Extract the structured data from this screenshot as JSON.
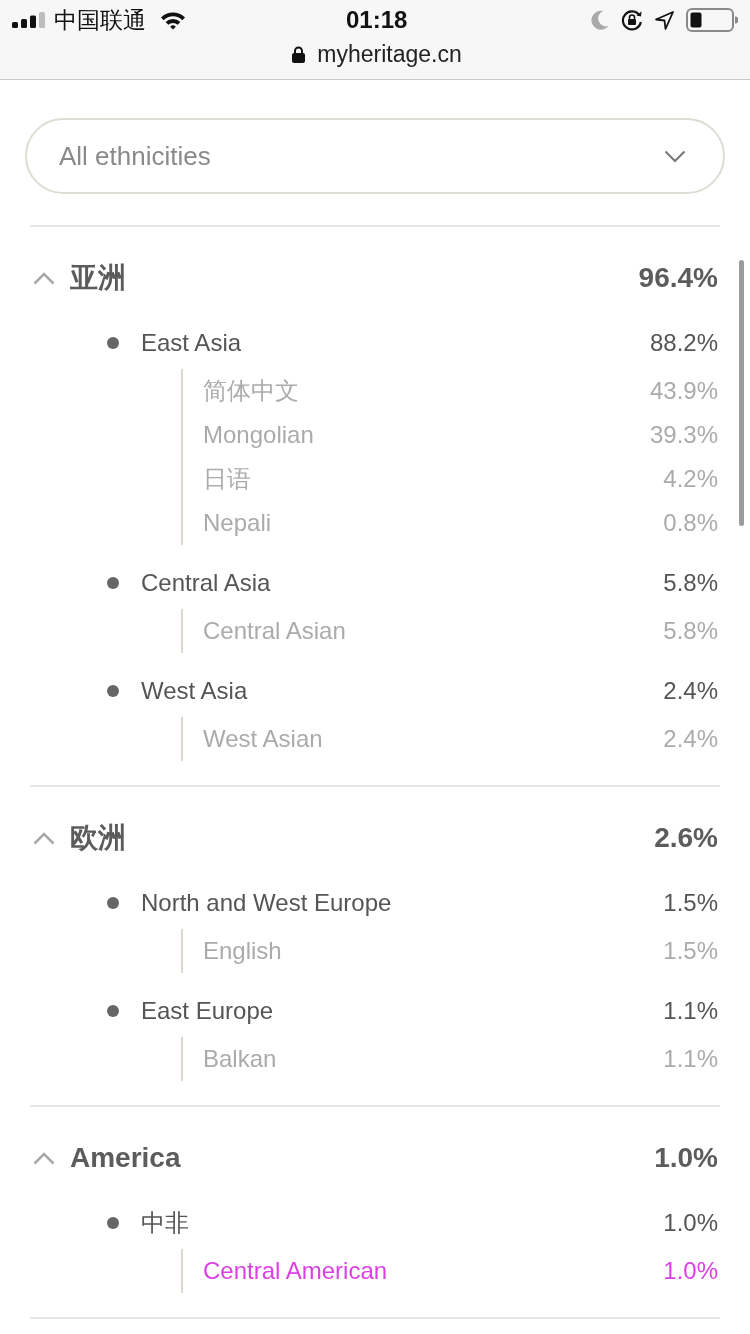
{
  "status_bar": {
    "carrier": "中国联通",
    "time": "01:18"
  },
  "address_bar": {
    "url": "myheritage.cn"
  },
  "filter": {
    "value": "All ethnicities"
  },
  "regions": [
    {
      "name": "亚洲",
      "percent": "96.4%",
      "expanded": true,
      "subregions": [
        {
          "name": "East Asia",
          "percent": "88.2%",
          "children": [
            {
              "name": "简体中文",
              "percent": "43.9%",
              "selected": false
            },
            {
              "name": "Mongolian",
              "percent": "39.3%",
              "selected": false
            },
            {
              "name": "日语",
              "percent": "4.2%",
              "selected": false
            },
            {
              "name": "Nepali",
              "percent": "0.8%",
              "selected": false
            }
          ]
        },
        {
          "name": "Central Asia",
          "percent": "5.8%",
          "children": [
            {
              "name": "Central Asian",
              "percent": "5.8%",
              "selected": false
            }
          ]
        },
        {
          "name": "West Asia",
          "percent": "2.4%",
          "children": [
            {
              "name": "West Asian",
              "percent": "2.4%",
              "selected": false
            }
          ]
        }
      ]
    },
    {
      "name": "欧洲",
      "percent": "2.6%",
      "expanded": true,
      "subregions": [
        {
          "name": "North and West Europe",
          "percent": "1.5%",
          "children": [
            {
              "name": "English",
              "percent": "1.5%",
              "selected": false
            }
          ]
        },
        {
          "name": "East Europe",
          "percent": "1.1%",
          "children": [
            {
              "name": "Balkan",
              "percent": "1.1%",
              "selected": false
            }
          ]
        }
      ]
    },
    {
      "name": "America",
      "percent": "1.0%",
      "expanded": true,
      "subregions": [
        {
          "name": "中非",
          "percent": "1.0%",
          "children": [
            {
              "name": "Central American",
              "percent": "1.0%",
              "selected": true
            }
          ]
        }
      ]
    }
  ]
}
